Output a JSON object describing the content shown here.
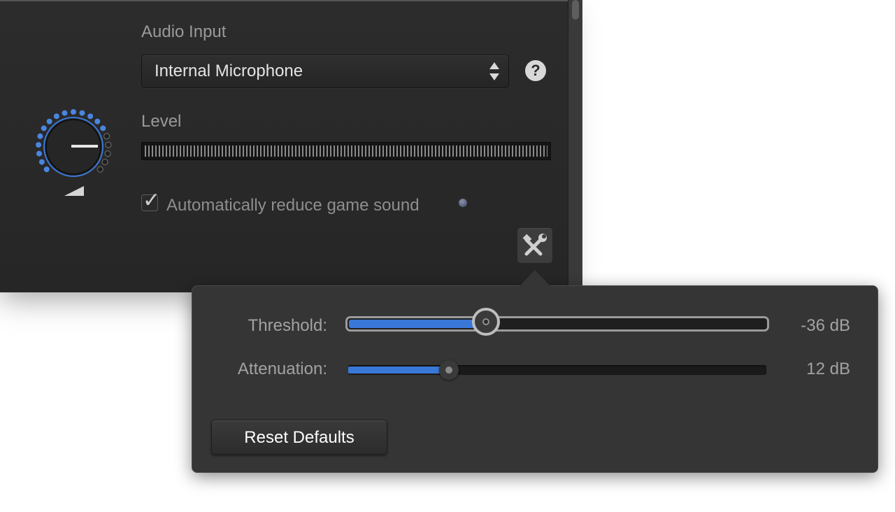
{
  "audio_input": {
    "label": "Audio Input",
    "selected": "Internal Microphone"
  },
  "help": {
    "glyph": "?"
  },
  "level": {
    "label": "Level"
  },
  "auto_reduce": {
    "label": "Automatically reduce game sound",
    "checked": true
  },
  "popover": {
    "threshold": {
      "label": "Threshold:",
      "value": "-36 dB",
      "fraction": 0.33
    },
    "attenuation": {
      "label": "Attenuation:",
      "value": "12 dB",
      "fraction": 0.24
    },
    "reset_label": "Reset Defaults"
  },
  "colors": {
    "accent": "#3a78d8",
    "panel": "#2a2a2a",
    "popover": "#353535"
  },
  "icons": {
    "tools": "tools-icon",
    "help": "help-icon",
    "select_arrows": "up-down-arrows-icon"
  }
}
